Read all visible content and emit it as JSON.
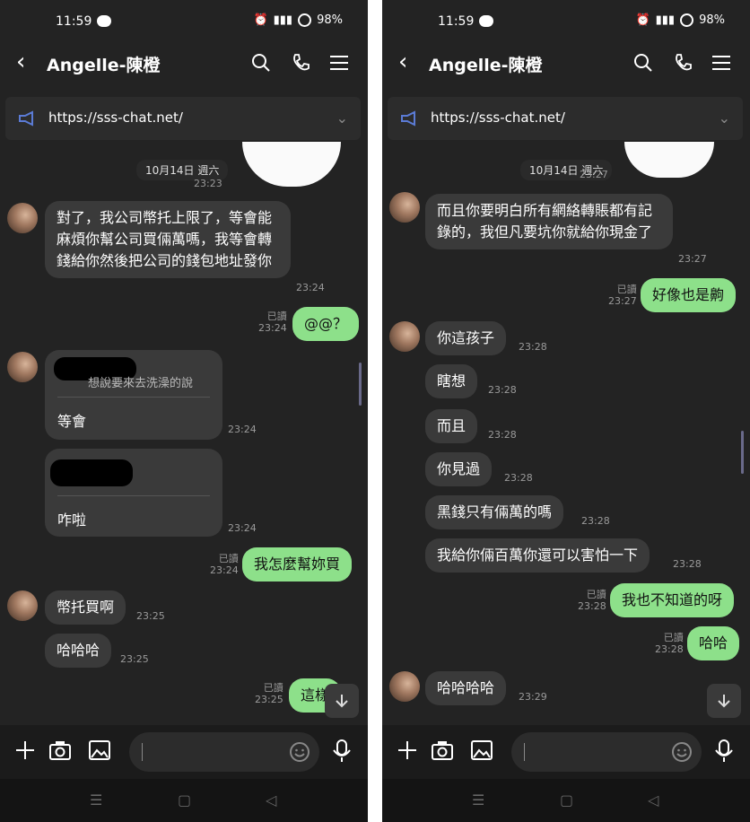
{
  "screens": [
    {
      "status": {
        "time": "11:59",
        "battery": "98%"
      },
      "header": {
        "title": "Angelle-陳橙"
      },
      "announcement": {
        "url": "https://sss-chat.net/"
      },
      "date_chip": "10月14日 週六",
      "date_time": "23:23",
      "messages": [
        {
          "text": "對了，我公司幣托上限了，等會能麻煩你幫公司買倆萬嗎，我等會轉錢給你然後把公司的錢包地址發你",
          "time": "23:24"
        },
        {
          "text": "@@？",
          "read": "已讀",
          "time": "23:24"
        },
        {
          "quote": "想說要來去洗澡的說",
          "text": "等會",
          "time": "23:24"
        },
        {
          "text": "咋啦",
          "time": "23:24"
        },
        {
          "text": "我怎麼幫妳買",
          "read": "已讀",
          "time": "23:24"
        },
        {
          "text": "幣托買啊",
          "time": "23:25"
        },
        {
          "text": "哈哈哈",
          "time": "23:25"
        },
        {
          "text": "這樣",
          "read": "已讀",
          "time": "23:25"
        }
      ]
    },
    {
      "status": {
        "time": "11:59",
        "battery": "98%"
      },
      "header": {
        "title": "Angelle-陳橙"
      },
      "announcement": {
        "url": "https://sss-chat.net/"
      },
      "date_chip": "10月14日 週六",
      "date_time": "23:27",
      "messages": [
        {
          "text": "而且你要明白所有網絡轉賬都有記錄的，我但凡要坑你就給你現金了",
          "time": "23:27"
        },
        {
          "text": "好像也是齁",
          "read": "已讀",
          "time": "23:27"
        },
        {
          "text": "你這孩子",
          "time": "23:28"
        },
        {
          "text": "瞎想",
          "time": "23:28"
        },
        {
          "text": "而且",
          "time": "23:28"
        },
        {
          "text": "你見過",
          "time": "23:28"
        },
        {
          "text": "黑錢只有倆萬的嗎",
          "time": "23:28"
        },
        {
          "text": "我給你倆百萬你還可以害怕一下",
          "time": "23:28"
        },
        {
          "text": "我也不知道的呀",
          "read": "已讀",
          "time": "23:28"
        },
        {
          "text": "哈哈",
          "read": "已讀",
          "time": "23:28"
        },
        {
          "text": "哈哈哈哈",
          "time": "23:29"
        }
      ]
    }
  ],
  "colors": {
    "background": "#232323",
    "outgoing_bubble": "#8de08a",
    "incoming_bubble": "#3a3a3a",
    "accent_icon": "#5b7bd5"
  },
  "icons": [
    "back-icon",
    "search-icon",
    "phone-icon",
    "menu-icon",
    "megaphone-icon",
    "chevron-down-icon",
    "plus-icon",
    "camera-icon",
    "image-icon",
    "emoji-icon",
    "mic-icon",
    "scroll-down-icon"
  ]
}
